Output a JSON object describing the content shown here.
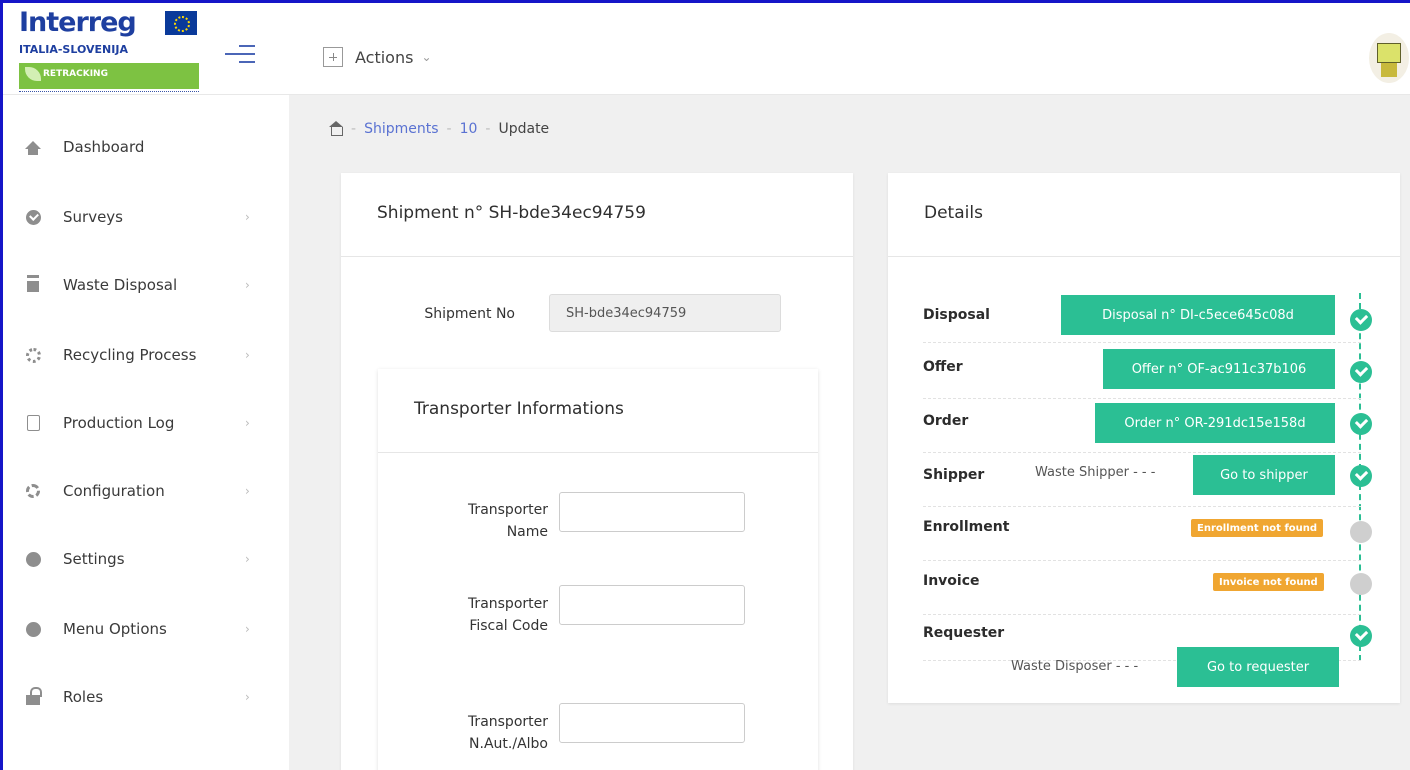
{
  "brand": {
    "name": "Interreg",
    "country": "ITALIA-SLOVENIJA",
    "subtitle": "RETRACKING"
  },
  "topbar": {
    "actions_label": "Actions",
    "caret": "⌄"
  },
  "sidebar": {
    "items": [
      {
        "label": "Dashboard",
        "icon": "home-icon",
        "chevron": ""
      },
      {
        "label": "Surveys",
        "icon": "check-circle-icon",
        "chevron": "›"
      },
      {
        "label": "Waste Disposal",
        "icon": "trash-icon",
        "chevron": "›"
      },
      {
        "label": "Recycling Process",
        "icon": "recycle-icon",
        "chevron": "›"
      },
      {
        "label": "Production Log",
        "icon": "clipboard-chart-icon",
        "chevron": "›"
      },
      {
        "label": "Configuration",
        "icon": "gears-icon",
        "chevron": "›"
      },
      {
        "label": "Settings",
        "icon": "circle-icon",
        "chevron": "›"
      },
      {
        "label": "Menu Options",
        "icon": "circle-icon",
        "chevron": "›"
      },
      {
        "label": "Roles",
        "icon": "unlock-icon",
        "chevron": "›"
      }
    ]
  },
  "breadcrumb": {
    "sep": "-",
    "items": [
      "Shipments",
      "10",
      "Update"
    ]
  },
  "shipment_card": {
    "title": "Shipment n° SH-bde34ec94759",
    "shipment_no_label": "Shipment No",
    "shipment_no_value": "SH-bde34ec94759"
  },
  "transporter_card": {
    "title": "Transporter Informations",
    "fields": [
      {
        "label": "Transporter Name",
        "value": ""
      },
      {
        "label": "Transporter Fiscal Code",
        "value": ""
      },
      {
        "label": "Transporter N.Aut./Albo",
        "value": ""
      }
    ]
  },
  "details": {
    "title": "Details",
    "colors": {
      "accent": "#2bbf94",
      "warning": "#f0a631"
    },
    "rows": [
      {
        "label": "Disposal",
        "button": "Disposal n° DI-c5ece645c08d",
        "status": "done"
      },
      {
        "label": "Offer",
        "button": "Offer n° OF-ac911c37b106",
        "status": "done"
      },
      {
        "label": "Order",
        "button": "Order n° OR-291dc15e158d",
        "status": "done"
      },
      {
        "label": "Shipper",
        "note": "Waste Shipper - - -",
        "button": "Go to shipper",
        "status": "done"
      },
      {
        "label": "Enrollment",
        "badge": "Enrollment not found",
        "status": "pending"
      },
      {
        "label": "Invoice",
        "badge": "Invoice not found",
        "status": "pending"
      },
      {
        "label": "Requester",
        "note": "Waste Disposer - - -",
        "button": "Go to requester",
        "status": "done"
      }
    ]
  }
}
